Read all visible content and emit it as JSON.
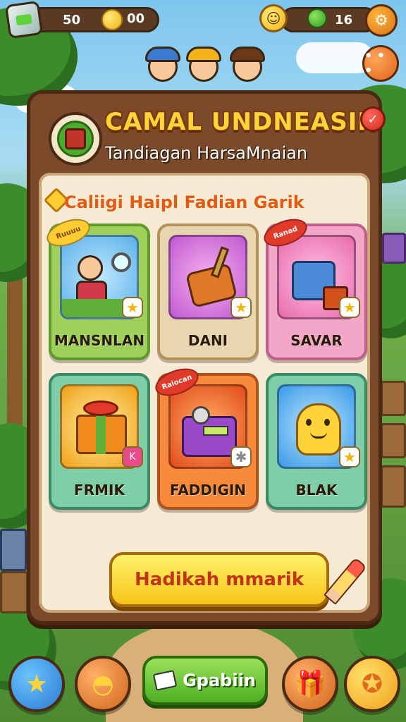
{
  "hud": {
    "gems": "50",
    "coins": "00",
    "energy": "16"
  },
  "panel": {
    "title": "CAMAL UNDNEASIN",
    "subtitle": "Tandiagan HarsaMnaian",
    "close_symbol": "✓",
    "section_label": "Caliigi Haipl Fadian Garik",
    "cards": [
      {
        "label": "MANSNLAN",
        "ribbon": "Ruuuu",
        "icon": "explorer-character-icon"
      },
      {
        "label": "DANI",
        "ribbon": "",
        "icon": "sword-hammer-icon"
      },
      {
        "label": "SAVAR",
        "ribbon": "Ranad",
        "icon": "treasure-chest-icon"
      },
      {
        "label": "FRMIK",
        "ribbon": "",
        "icon": "gift-box-icon"
      },
      {
        "label": "FADDIGIN",
        "ribbon": "Raiocan",
        "icon": "robot-machine-icon"
      },
      {
        "label": "BLAK",
        "ribbon": "",
        "icon": "smiling-pot-icon"
      }
    ],
    "claim_button": "Hadikah mmarik"
  },
  "bottom_bar": {
    "play_label": "Gpabiin"
  },
  "colors": {
    "accent_yellow": "#ffd43a",
    "panel_brown": "#7b4a2a",
    "play_green": "#4eae22",
    "claim_text": "#c0341a"
  }
}
